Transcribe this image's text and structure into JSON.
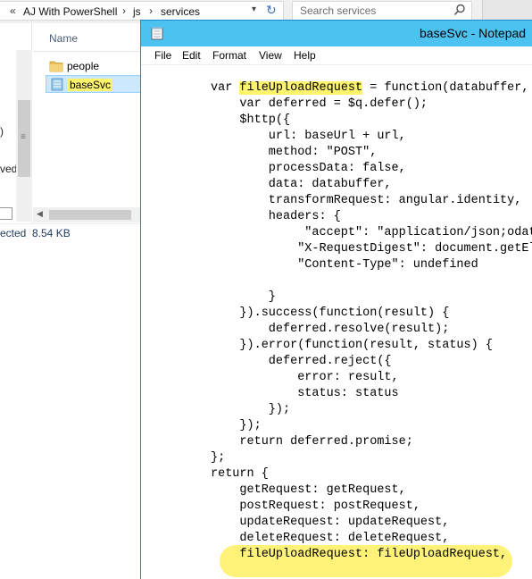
{
  "explorer": {
    "breadcrumbs": [
      "«",
      "AJ With PowerShell",
      "js",
      "services"
    ],
    "search_placeholder": "Search services",
    "nav_fragments": [
      ")",
      "ved"
    ],
    "column_name": "Name",
    "files": [
      {
        "name": "people",
        "type": "folder"
      },
      {
        "name": "baseSvc",
        "type": "file",
        "selected": true
      }
    ],
    "status_selected": "ected",
    "status_size": "8.54 KB"
  },
  "notepad": {
    "title": "baseSvc - Notepad",
    "menu": [
      "File",
      "Edit",
      "Format",
      "View",
      "Help"
    ],
    "code_lines": [
      {
        "indent": 0,
        "pre": "var ",
        "hl": "fileUploadRequest",
        "post": " = function(databuffer,"
      },
      {
        "indent": 1,
        "text": "var deferred = $q.defer();"
      },
      {
        "indent": 1,
        "text": "$http({"
      },
      {
        "indent": 2,
        "text": "url: baseUrl + url,"
      },
      {
        "indent": 2,
        "text": "method: \"POST\","
      },
      {
        "indent": 2,
        "text": "processData: false,"
      },
      {
        "indent": 2,
        "text": "data: databuffer,"
      },
      {
        "indent": 2,
        "text": "transformRequest: angular.identity,"
      },
      {
        "indent": 2,
        "text": "headers: {"
      },
      {
        "indent": 3.25,
        "text": "\"accept\": \"application/json;odat"
      },
      {
        "indent": 3,
        "text": "\"X-RequestDigest\": document.getEl"
      },
      {
        "indent": 3,
        "text": "\"Content-Type\": undefined"
      },
      {
        "indent": 0,
        "text": ""
      },
      {
        "indent": 2,
        "text": "}"
      },
      {
        "indent": 1,
        "text": "}).success(function(result) {"
      },
      {
        "indent": 2,
        "text": "deferred.resolve(result);"
      },
      {
        "indent": 1,
        "text": "}).error(function(result, status) {"
      },
      {
        "indent": 2,
        "text": "deferred.reject({"
      },
      {
        "indent": 3,
        "text": "error: result,"
      },
      {
        "indent": 3,
        "text": "status: status"
      },
      {
        "indent": 2,
        "text": "});"
      },
      {
        "indent": 1,
        "text": "});"
      },
      {
        "indent": 1,
        "text": "return deferred.promise;"
      },
      {
        "indent": 0,
        "text": "};"
      },
      {
        "indent": 0,
        "text": "return {"
      },
      {
        "indent": 1,
        "text": "getRequest: getRequest,"
      },
      {
        "indent": 1,
        "text": "postRequest: postRequest,"
      },
      {
        "indent": 1,
        "text": "updateRequest: updateRequest,"
      },
      {
        "indent": 1,
        "text": "deleteRequest: deleteRequest,"
      },
      {
        "indent": 1,
        "text": "fileUploadRequest: fileUploadRequest,"
      }
    ]
  },
  "colors": {
    "titlebar": "#4cc2f1",
    "highlight": "#fdf36d",
    "selection": "#cce8ff",
    "folder": "#e8c057"
  }
}
